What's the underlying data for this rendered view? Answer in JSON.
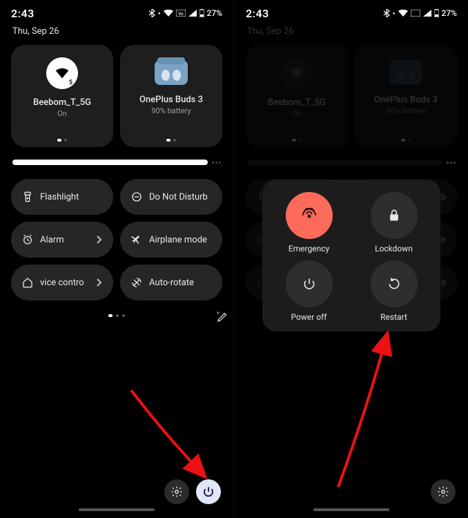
{
  "status": {
    "time": "2:43",
    "date": "Thu, Sep 26",
    "battery": "27%"
  },
  "tiles": [
    {
      "title": "Beebom_T_5G",
      "sub": "On",
      "subnum": "5"
    },
    {
      "title": "OnePlus Buds 3",
      "sub": "90% battery"
    }
  ],
  "qs": {
    "flashlight": "Flashlight",
    "dnd": "Do Not Disturb",
    "alarm": "Alarm",
    "airplane": "Airplane mode",
    "device": "Device controls",
    "autorotate": "Auto-rotate"
  },
  "power": {
    "emergency": "Emergency",
    "lockdown": "Lockdown",
    "poweroff": "Power off",
    "restart": "Restart"
  }
}
